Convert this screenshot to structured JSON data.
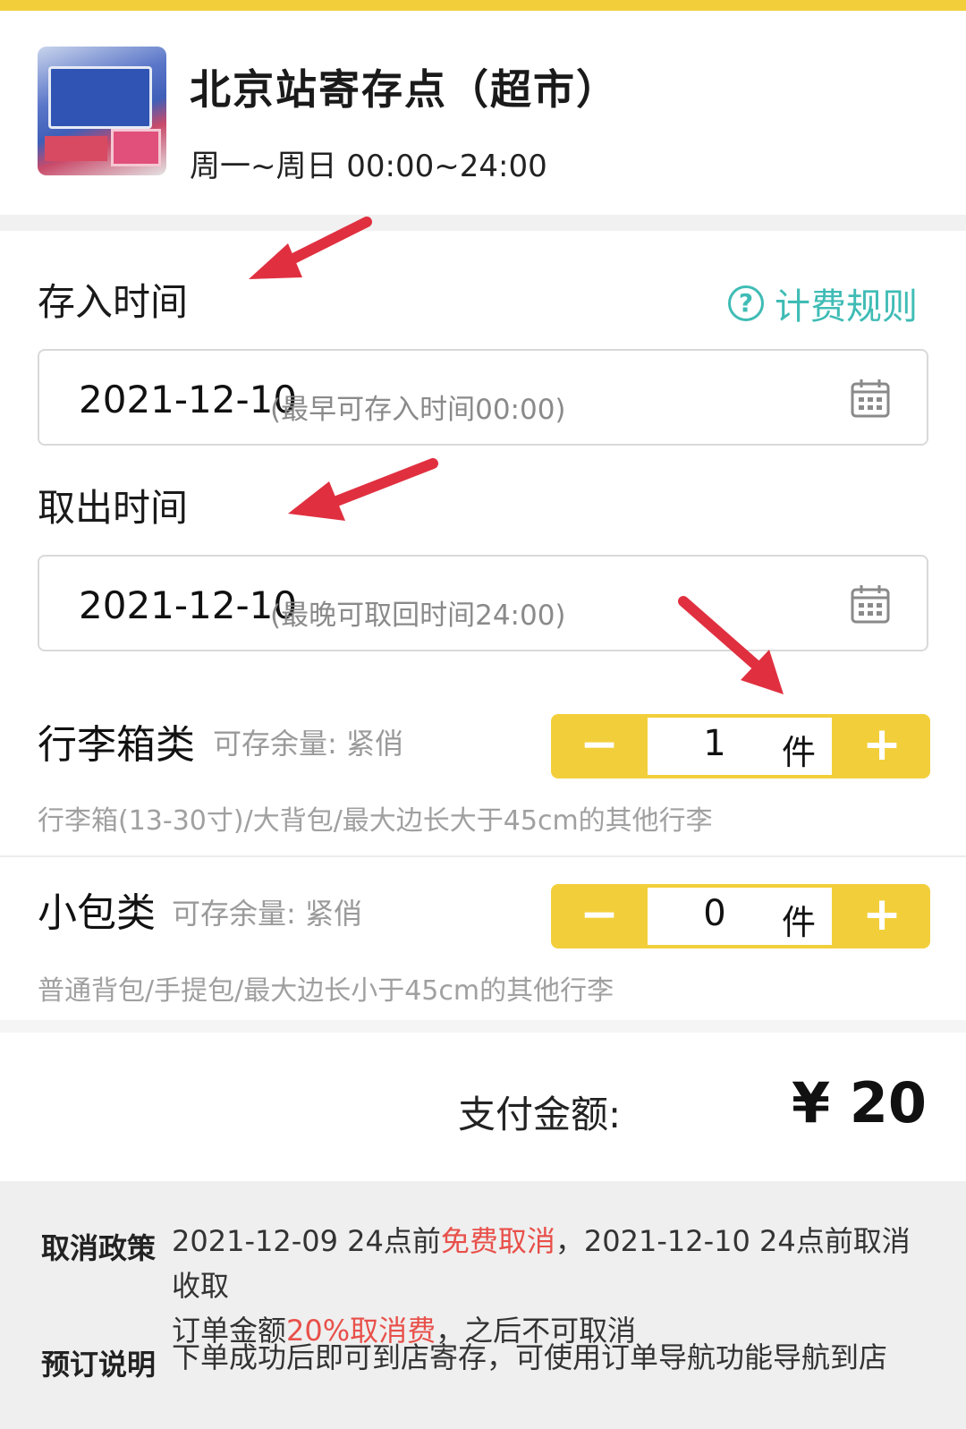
{
  "store": {
    "name": "北京站寄存点（超市）",
    "hours": "周一~周日 00:00~24:00"
  },
  "deposit": {
    "label": "存入时间",
    "date": "2021-12-10",
    "hint": "(最早可存入时间00:00)"
  },
  "pricing_rules": {
    "label": "计费规则",
    "icon": "question-circle-icon"
  },
  "pickup": {
    "label": "取出时间",
    "date": "2021-12-10",
    "hint": "(最晚可取回时间24:00)"
  },
  "luggage": [
    {
      "title": "行李箱类",
      "availability": "可存余量: 紧俏",
      "description": "行李箱(13-30寸)/大背包/最大边长大于45cm的其他行李",
      "count": "1",
      "unit": "件",
      "minus": "−",
      "plus": "+"
    },
    {
      "title": "小包类",
      "availability": "可存余量: 紧俏",
      "description": "普通背包/手提包/最大边长小于45cm的其他行李",
      "count": "0",
      "unit": "件",
      "minus": "−",
      "plus": "+"
    }
  ],
  "payment": {
    "label": "支付金额:",
    "amount": "¥ 20"
  },
  "policy": {
    "cancel_label": "取消政策",
    "cancel_text_1": "2021-12-09 24点前",
    "cancel_free": "免费取消",
    "cancel_text_2": "，2021-12-10 24点前取消收取",
    "cancel_text_3": "订单金额",
    "cancel_fee": "20%取消费",
    "cancel_text_4": "，之后不可取消",
    "booking_label": "预订说明",
    "booking_text": "下单成功后即可到店寄存，可使用订单导航功能导航到店"
  },
  "colors": {
    "accent_yellow": "#f2cf3a",
    "link_teal": "#3fbcb5",
    "highlight_red": "#e8504a",
    "annotation_arrow": "#e03040"
  }
}
